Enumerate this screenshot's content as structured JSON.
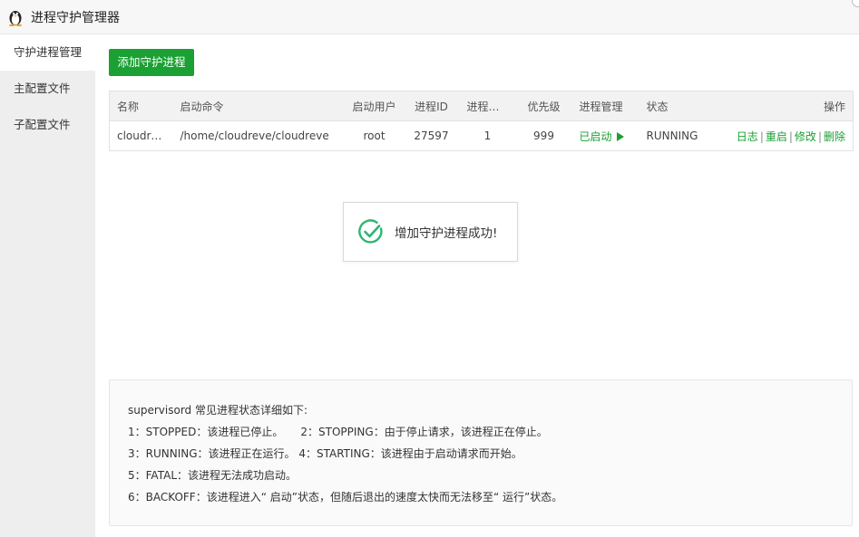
{
  "app": {
    "title": "进程守护管理器"
  },
  "sidebar": {
    "items": [
      {
        "label": "守护进程管理",
        "active": true
      },
      {
        "label": "主配置文件",
        "active": false
      },
      {
        "label": "子配置文件",
        "active": false
      }
    ]
  },
  "toolbar": {
    "add_label": "添加守护进程"
  },
  "table": {
    "headers": [
      "名称",
      "启动命令",
      "启动用户",
      "进程ID",
      "进程数量",
      "优先级",
      "进程管理",
      "状态",
      "操作"
    ],
    "rows": [
      {
        "name": "cloudr…",
        "command": "/home/cloudreve/cloudreve",
        "user": "root",
        "pid": "27597",
        "count": "1",
        "priority": "999",
        "manage": "已启动",
        "status": "RUNNING",
        "ops": [
          "日志",
          "重启",
          "修改",
          "删除"
        ]
      }
    ]
  },
  "toast": {
    "message": "增加守护进程成功!"
  },
  "info": {
    "lines": [
      "supervisord 常见进程状态详细如下:",
      "1：STOPPED：该进程已停止。     2：STOPPING：由于停止请求，该进程正在停止。",
      "3：RUNNING：该进程正在运行。 4：STARTING：该进程由于启动请求而开始。",
      "5：FATAL：该进程无法成功启动。",
      "6：BACKOFF：该进程进入“ 启动”状态，但随后退出的速度太快而无法移至“ 运行”状态。"
    ]
  },
  "colors": {
    "accent": "#1aa033",
    "sidebar_bg": "#eeeeee",
    "titlebar_bg": "#f7f7f7"
  },
  "icons": {
    "app": "penguin-icon",
    "toast": "check-circle-icon",
    "manage": "play-icon"
  }
}
